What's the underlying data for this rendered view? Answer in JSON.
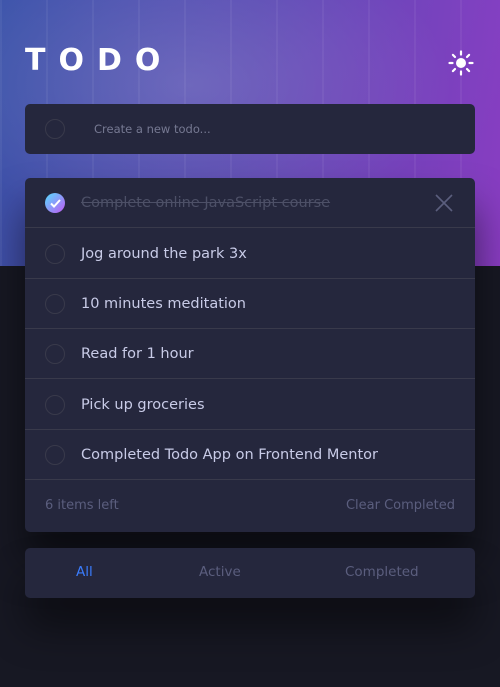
{
  "header": {
    "title": "TODO",
    "theme_icon": "sun-icon"
  },
  "new_todo": {
    "placeholder": "Create a new todo..."
  },
  "todos": [
    {
      "text": "Complete online JavaScript course",
      "completed": true
    },
    {
      "text": "Jog around the park 3x",
      "completed": false
    },
    {
      "text": "10 minutes meditation",
      "completed": false
    },
    {
      "text": "Read for 1 hour",
      "completed": false
    },
    {
      "text": "Pick up groceries",
      "completed": false
    },
    {
      "text": "Completed Todo App on Frontend Mentor",
      "completed": false
    }
  ],
  "footer": {
    "items_left": "6 items left",
    "clear_label": "Clear Completed"
  },
  "filters": {
    "all": "All",
    "active": "Active",
    "completed": "Completed",
    "selected": "All"
  },
  "colors": {
    "page_bg": "#171823",
    "card_bg": "#25273d",
    "divider": "#393a4b",
    "text": "#c8cbe7",
    "muted": "#5b5e7e",
    "accent": "#3a7cfd",
    "check_from": "#55ddff",
    "check_to": "#c058f3"
  }
}
